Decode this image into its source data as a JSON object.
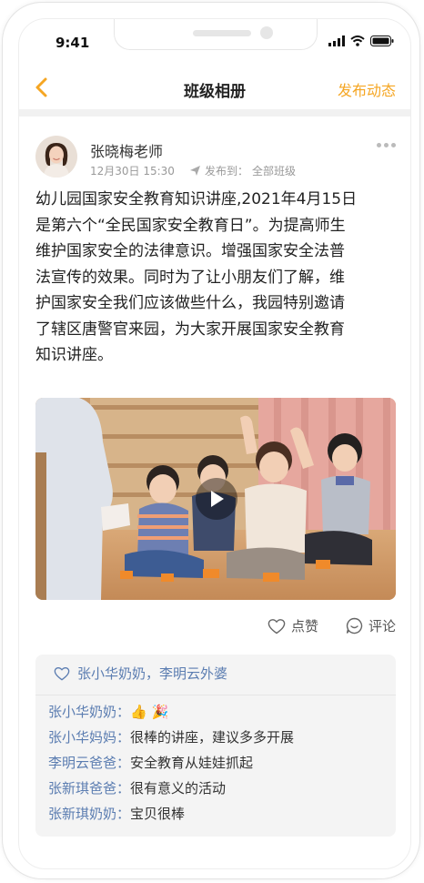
{
  "status_bar": {
    "time": "9:41"
  },
  "nav": {
    "title": "班级相册",
    "action_label": "发布动态"
  },
  "post": {
    "author": "张晓梅老师",
    "timestamp": "12月30日 15:30",
    "publish_to_label": "发布到：",
    "publish_to_value": "全部班级",
    "text_lines": [
      "幼儿园国家安全教育知识讲座,2021年4月15日",
      "是第六个“全民国家安全教育日”。为提高师生",
      "维护国家安全的法律意识。增强国家安全法普",
      "法宣传的效果。同时为了让小朋友们了解，维",
      "护国家安全我们应该做些什么，我园特别邀请",
      "了辖区唐警官来园，为大家开展国家安全教育",
      "知识讲座。"
    ]
  },
  "actions": {
    "like_label": "点赞",
    "comment_label": "评论"
  },
  "likes": {
    "names": "张小华奶奶，李明云外婆"
  },
  "comments": [
    {
      "name": "张小华奶奶：",
      "text": "👍 🎉"
    },
    {
      "name": "张小华妈妈：",
      "text": "很棒的讲座，建议多多开展"
    },
    {
      "name": "李明云爸爸：",
      "text": "安全教育从娃娃抓起"
    },
    {
      "name": "张新琪爸爸：",
      "text": "很有意义的活动"
    },
    {
      "name": "张新琪奶奶：",
      "text": "宝贝很棒"
    }
  ],
  "colors": {
    "accent": "#f5a623",
    "link": "#5b7db1"
  },
  "icons": [
    "back-chevron-icon",
    "more-icon",
    "send-icon",
    "play-icon",
    "heart-icon",
    "comment-icon",
    "signal-icon",
    "wifi-icon",
    "battery-icon"
  ]
}
